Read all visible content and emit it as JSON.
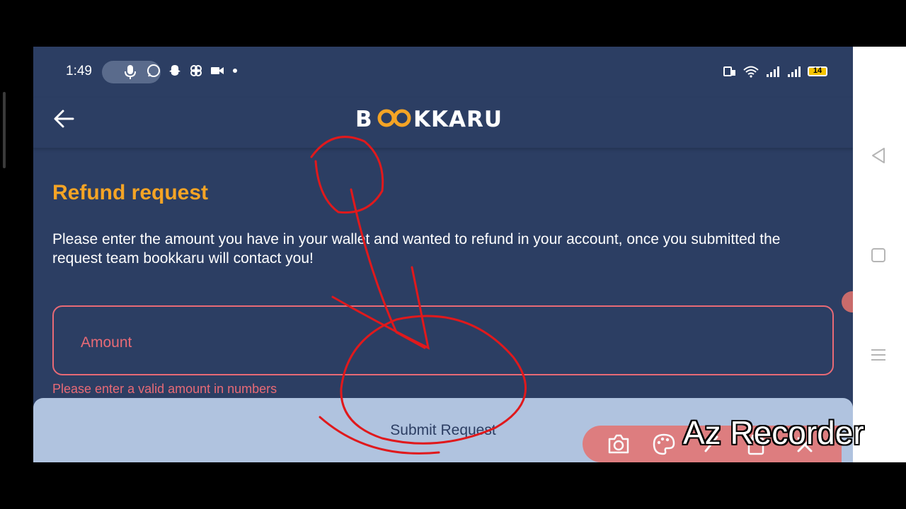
{
  "status_bar": {
    "time": "1:49",
    "battery": "14",
    "notification_icons": [
      "whatsapp-icon",
      "snapchat-icon",
      "pinwheel-icon",
      "video-icon",
      "dot-icon"
    ],
    "system_icons": [
      "cast-icon",
      "wifi-icon",
      "signal-icon",
      "signal-icon",
      "battery-icon"
    ]
  },
  "header": {
    "logo_text": "BOOKKARU"
  },
  "page": {
    "title": "Refund request",
    "description": "Please enter the amount you have in your wallet and wanted to refund in your account, once you submitted the request team bookkaru will contact you!"
  },
  "form": {
    "amount_placeholder": "Amount",
    "amount_value": "",
    "error_message": "Please enter a valid amount in numbers",
    "submit_label": "Submit Request"
  },
  "recorder": {
    "watermark": "Az Recorder",
    "icons": [
      "camera-icon",
      "palette-icon",
      "brush-icon",
      "clipboard-icon",
      "close-icon"
    ]
  },
  "colors": {
    "background": "#2c3e63",
    "accent": "#f5a425",
    "error": "#e86a76",
    "submit_bg": "#b0c3df",
    "annotation": "#e0191c"
  }
}
